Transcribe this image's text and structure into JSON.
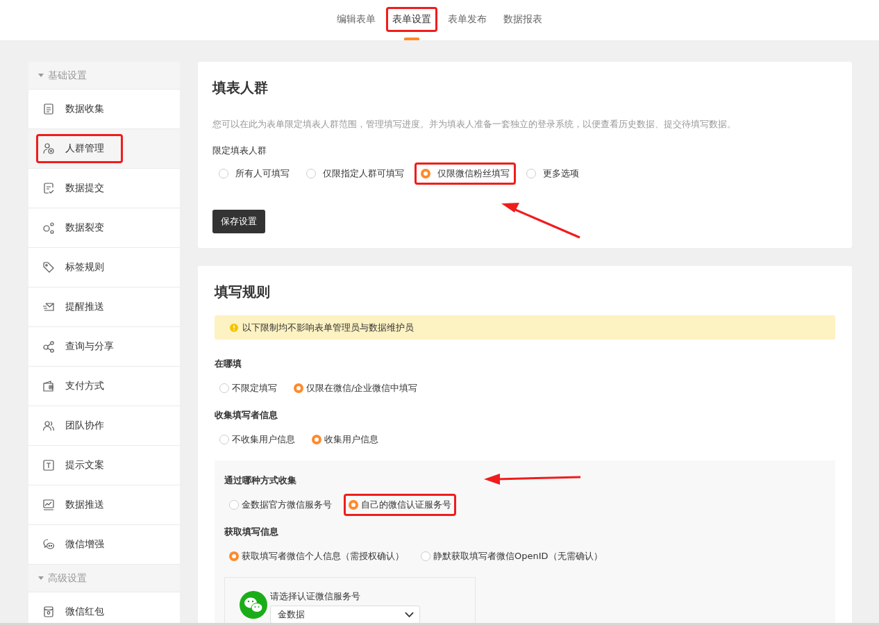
{
  "top_tabs": [
    {
      "label": "编辑表单",
      "selected": false,
      "highlighted": false
    },
    {
      "label": "表单设置",
      "selected": true,
      "highlighted": true
    },
    {
      "label": "表单发布",
      "selected": false,
      "highlighted": false
    },
    {
      "label": "数据报表",
      "selected": false,
      "highlighted": false
    }
  ],
  "sidebar": {
    "sections": [
      {
        "title": "基础设置",
        "expanded": true,
        "items": [
          {
            "label": "数据收集",
            "selected": false,
            "highlighted": false
          },
          {
            "label": "人群管理",
            "selected": true,
            "highlighted": true
          },
          {
            "label": "数据提交",
            "selected": false,
            "highlighted": false
          },
          {
            "label": "数据裂变",
            "selected": false,
            "highlighted": false
          },
          {
            "label": "标签规则",
            "selected": false,
            "highlighted": false
          },
          {
            "label": "提醒推送",
            "selected": false,
            "highlighted": false
          },
          {
            "label": "查询与分享",
            "selected": false,
            "highlighted": false
          },
          {
            "label": "支付方式",
            "selected": false,
            "highlighted": false
          },
          {
            "label": "团队协作",
            "selected": false,
            "highlighted": false
          },
          {
            "label": "提示文案",
            "selected": false,
            "highlighted": false
          },
          {
            "label": "数据推送",
            "selected": false,
            "highlighted": false
          },
          {
            "label": "微信增强",
            "selected": false,
            "highlighted": false
          }
        ]
      },
      {
        "title": "高级设置",
        "expanded": true,
        "items": [
          {
            "label": "微信红包",
            "selected": false,
            "highlighted": false
          }
        ]
      }
    ]
  },
  "audience_card": {
    "title": "填表人群",
    "description": "您可以在此为表单限定填表人群范围，管理填写进度。并为填表人准备一套独立的登录系统，以便查看历史数据、提交待填写数据。",
    "field_label": "限定填表人群",
    "options": [
      {
        "label": "所有人可填写",
        "selected": false,
        "highlighted": false
      },
      {
        "label": "仅限指定人群可填写",
        "selected": false,
        "highlighted": false
      },
      {
        "label": "仅限微信粉丝填写",
        "selected": true,
        "highlighted": true
      },
      {
        "label": "更多选项",
        "selected": false,
        "highlighted": false
      }
    ],
    "save_button": "保存设置"
  },
  "rules_card": {
    "title": "填写规则",
    "notice": "以下限制均不影响表单管理员与数据维护员",
    "groups": [
      {
        "label": "在哪填",
        "options": [
          {
            "label": "不限定填写",
            "selected": false,
            "highlighted": false
          },
          {
            "label": "仅限在微信/企业微信中填写",
            "selected": true,
            "highlighted": false
          }
        ]
      },
      {
        "label": "收集填写者信息",
        "options": [
          {
            "label": "不收集用户信息",
            "selected": false,
            "highlighted": false
          },
          {
            "label": "收集用户信息",
            "selected": true,
            "highlighted": false
          }
        ]
      }
    ],
    "collect_panel": {
      "groups": [
        {
          "label": "通过哪种方式收集",
          "options": [
            {
              "label": "金数据官方微信服务号",
              "selected": false,
              "highlighted": false
            },
            {
              "label": "自己的微信认证服务号",
              "selected": true,
              "highlighted": true
            }
          ]
        },
        {
          "label": "获取填写信息",
          "options": [
            {
              "label": "获取填写者微信个人信息（需授权确认）",
              "selected": true,
              "highlighted": false
            },
            {
              "label": "静默获取填写者微信OpenID（无需确认）",
              "selected": false,
              "highlighted": false
            }
          ]
        }
      ],
      "account_picker": {
        "label": "请选择认证微信服务号",
        "value": "金数据"
      }
    }
  }
}
